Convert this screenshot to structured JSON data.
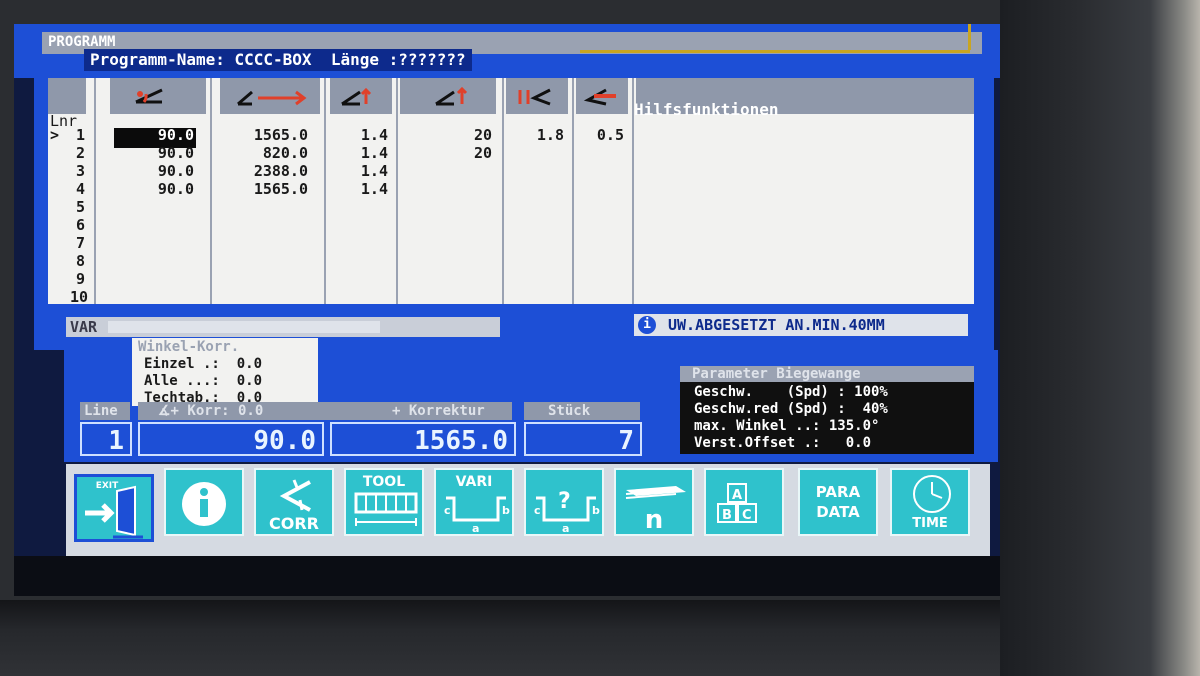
{
  "header": {
    "title": "PROGRAMM",
    "program_line": "Programm-Name: CCCC-BOX  Länge :???????"
  },
  "table": {
    "lnr_header": "Lnr",
    "cursor": ">",
    "aux_header": "Hilfsfunktionen",
    "row_numbers": [
      "1",
      "2",
      "3",
      "4",
      "5",
      "6",
      "7",
      "8",
      "9",
      "10"
    ],
    "column_icons": [
      "angle-icon",
      "backgauge-x-icon",
      "backgauge-r-icon",
      "flange-height-icon",
      "tool-width-icon",
      "sheet-thickness-icon"
    ],
    "rows": [
      {
        "angle": "90.0",
        "x": "1565.0",
        "r": "1.4",
        "h": "20",
        "w": "1.8",
        "t": "0.5"
      },
      {
        "angle": "90.0",
        "x": "820.0",
        "r": "1.4",
        "h": "20",
        "w": "",
        "t": ""
      },
      {
        "angle": "90.0",
        "x": "2388.0",
        "r": "1.4",
        "h": "",
        "w": "",
        "t": ""
      },
      {
        "angle": "90.0",
        "x": "1565.0",
        "r": "1.4",
        "h": "",
        "w": "",
        "t": ""
      }
    ]
  },
  "status": {
    "var_label": "VAR",
    "info_message": "UW.ABGESETZT AN.MIN.40MM"
  },
  "winkel_korr": {
    "title": "Winkel-Korr.",
    "rows": [
      "Einzel .:  0.0",
      "Alle ...:  0.0",
      "Techtab.:  0.0"
    ]
  },
  "fields": {
    "line_label": "Line",
    "line_value": "1",
    "angle_label": "∡+ Korr: 0.0",
    "angle_value": "90.0",
    "x_label": "+ Korrektur",
    "x_value": "1565.0",
    "stueck_label": "Stück",
    "stueck_value": "7"
  },
  "parameters": {
    "title": "Parameter Biegewange",
    "rows": [
      "Geschw.    (Spd) : 100%",
      "Geschw.red (Spd) :  40%",
      "max. Winkel ..: 135.0°",
      "Verst.Offset .:   0.0"
    ]
  },
  "buttons": [
    {
      "id": "exit",
      "caption": "EXIT",
      "icon": "exit-door-icon"
    },
    {
      "id": "info",
      "caption": "",
      "icon": "info-icon"
    },
    {
      "id": "corr",
      "caption": "CORR",
      "icon": "correction-icon"
    },
    {
      "id": "tool",
      "caption": "TOOL",
      "icon": "tool-icon"
    },
    {
      "id": "vari",
      "caption": "VARI",
      "icon": "profile-variant-icon"
    },
    {
      "id": "query",
      "caption": "",
      "icon": "profile-query-icon"
    },
    {
      "id": "count",
      "caption": "n",
      "icon": "sheet-stack-icon"
    },
    {
      "id": "abc",
      "caption": "",
      "icon": "abc-blocks-icon"
    },
    {
      "id": "para",
      "caption": "PARA DATA",
      "icon": "parameter-icon"
    },
    {
      "id": "time",
      "caption": "TIME",
      "icon": "clock-icon"
    }
  ],
  "colors": {
    "screen_blue": "#1d4fd6",
    "button_cyan": "#2fc2cc",
    "accent_red": "#e0402a",
    "gold": "#c9a520"
  }
}
